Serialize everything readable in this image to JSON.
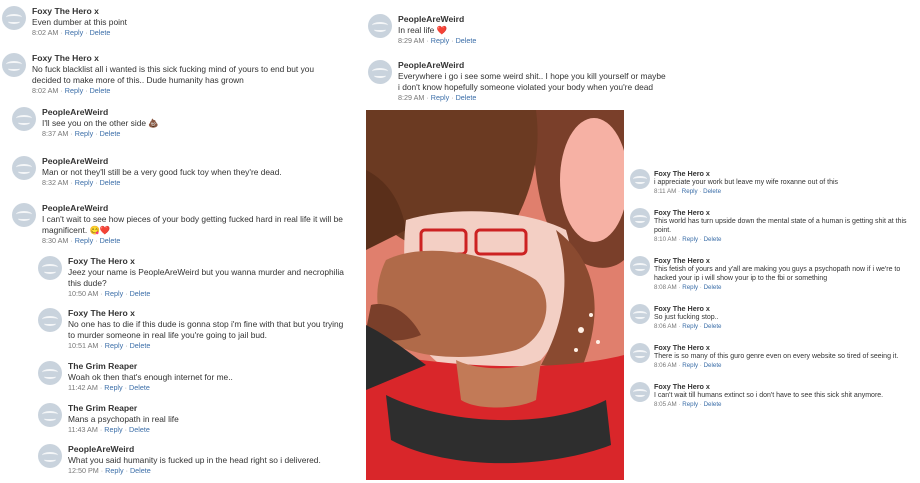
{
  "actions": {
    "reply": "Reply",
    "delete": "Delete",
    "separator": "·"
  },
  "left_comments": [
    {
      "author": "Foxy The Hero x",
      "text": "Even dumber at this point",
      "emoji": "",
      "time": "8:02 AM"
    },
    {
      "author": "Foxy The Hero x",
      "text": "No fuck blacklist all i wanted is this sick fucking mind of yours to end but you decided to make more of this.. Dude humanity has grown",
      "emoji": "",
      "time": "8:02 AM"
    },
    {
      "author": "PeopleAreWeird",
      "text": "I'll see you on the other side",
      "emoji": "💩",
      "time": "8:37 AM"
    },
    {
      "author": "PeopleAreWeird",
      "text": "Man or not they'll still be a very good fuck toy when they're dead.",
      "emoji": "",
      "time": "8:32 AM"
    },
    {
      "author": "PeopleAreWeird",
      "text": "I can't wait to see how pieces of your body getting fucked hard in real life it will be magnificent.",
      "emoji": "😋❤️",
      "time": "8:30 AM"
    },
    {
      "author": "Foxy The Hero x",
      "text": "Jeez your name is PeopleAreWeird but you wanna murder and necrophilia this dude?",
      "emoji": "",
      "time": "10:50 AM"
    },
    {
      "author": "Foxy The Hero x",
      "text": "No one has to die if this dude is gonna stop i'm fine with that but you trying to murder someone in real life you're going to jail bud.",
      "emoji": "",
      "time": "10:51 AM"
    },
    {
      "author": "The Grim Reaper",
      "text": "Woah ok then that's enough internet for me..",
      "emoji": "",
      "time": "11:42 AM"
    },
    {
      "author": "The Grim Reaper",
      "text": "Mans a psychopath in real life",
      "emoji": "",
      "time": "11:43 AM"
    },
    {
      "author": "PeopleAreWeird",
      "text": "What you said humanity is fucked up in the head right so i delivered.",
      "emoji": "",
      "time": "12:50 PM"
    }
  ],
  "top_right_comments": [
    {
      "author": "PeopleAreWeird",
      "text": "In real life",
      "emoji": "❤️",
      "time": "8:29 AM"
    },
    {
      "author": "PeopleAreWeird",
      "text": "Everywhere i go i see some weird shit.. I hope you kill yourself or maybe i don't know hopefully someone violated your body when you're dead",
      "emoji": "",
      "time": "8:29 AM"
    }
  ],
  "side_comments": [
    {
      "author": "Foxy The Hero x",
      "text": "i appreciate your work but leave my wife roxanne out of this",
      "emoji": "",
      "time": "8:11 AM"
    },
    {
      "author": "Foxy The Hero x",
      "text": "This world has turn upside down the mental state of a human is getting shit at this point.",
      "emoji": "",
      "time": "8:10 AM"
    },
    {
      "author": "Foxy The Hero x",
      "text": "This fetish of yours and y'all are making you guys a psychopath now if i we're to hacked your ip i will show your ip to the fbi or something",
      "emoji": "",
      "time": "8:08 AM"
    },
    {
      "author": "Foxy The Hero x",
      "text": "So just fucking stop..",
      "emoji": "",
      "time": "8:06 AM"
    },
    {
      "author": "Foxy The Hero x",
      "text": "There is so many of this guro genre even on every website so tired of seeing it.",
      "emoji": "",
      "time": "8:06 AM"
    },
    {
      "author": "Foxy The Hero x",
      "text": "I can't wait till humans extinct so i don't have to see this sick shit anymore.",
      "emoji": "",
      "time": "8:05 AM"
    }
  ],
  "colors": {
    "link": "#3b6ea8",
    "avatar": "#c9d3dd",
    "artwork_bg": "#e07f6d"
  }
}
